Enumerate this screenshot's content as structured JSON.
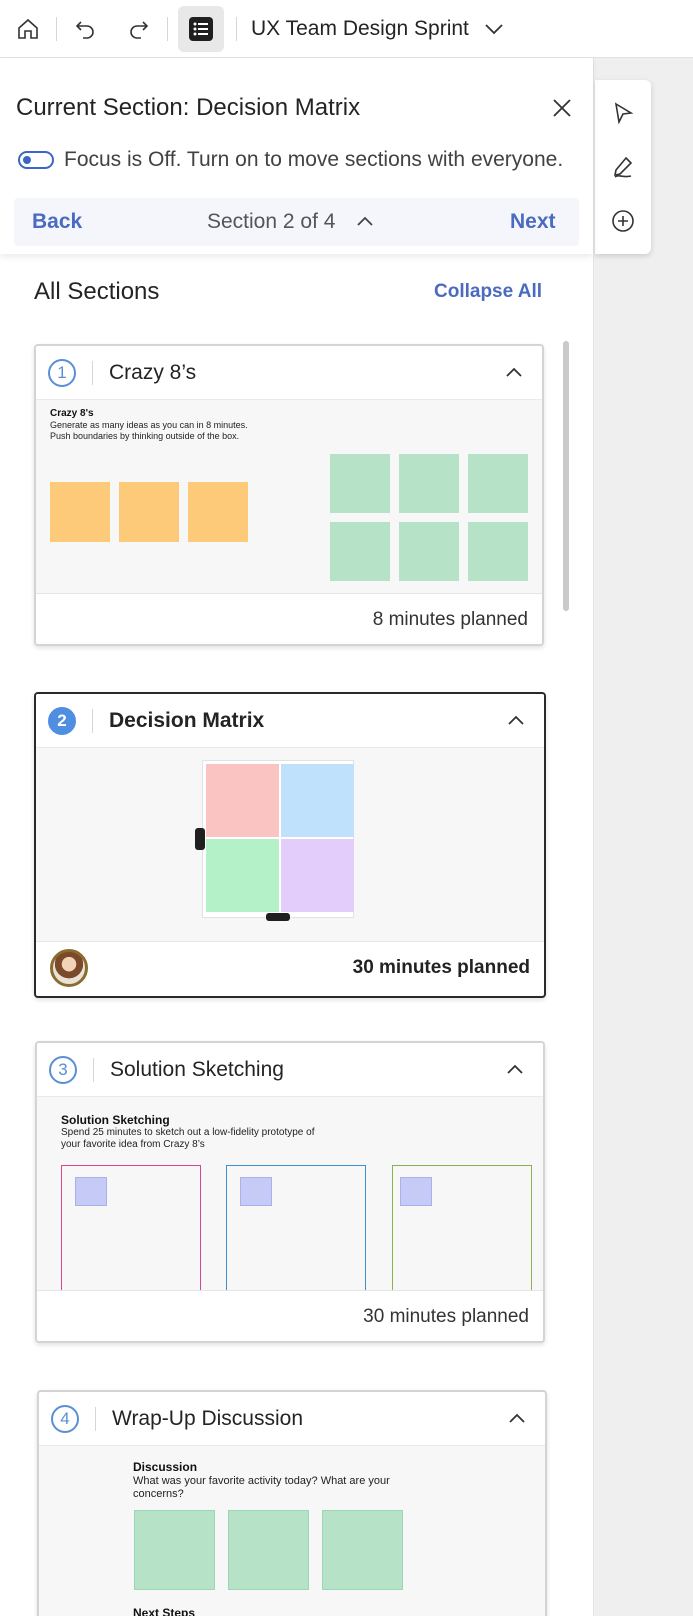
{
  "toolbar": {
    "board_title": "UX Team Design Sprint",
    "icons": [
      "home-icon",
      "undo-icon",
      "redo-icon",
      "sections-list-icon",
      "chevron-down-icon"
    ]
  },
  "right_tools": [
    "select-pointer-icon",
    "pen-icon",
    "add-icon"
  ],
  "panel": {
    "current_section_title": "Current Section: Decision Matrix",
    "focus_text": "Focus is Off. Turn on to move sections with everyone.",
    "back_label": "Back",
    "section_position": "Section 2 of 4",
    "next_label": "Next",
    "all_sections_label": "All Sections",
    "collapse_all_label": "Collapse All"
  },
  "sections": [
    {
      "number": "1",
      "title": "Crazy 8’s",
      "planned": "8 minutes planned",
      "preview_title": "Crazy 8's",
      "preview_text": "Generate as many ideas as you can in 8 minutes. Push boundaries by thinking outside of the box."
    },
    {
      "number": "2",
      "title": "Decision Matrix",
      "planned": "30 minutes planned",
      "active": true
    },
    {
      "number": "3",
      "title": "Solution Sketching",
      "planned": "30 minutes planned",
      "preview_title": "Solution Sketching",
      "preview_text": "Spend 25 minutes to sketch out a low-fidelity prototype of your favorite idea from Crazy 8’s"
    },
    {
      "number": "4",
      "title": "Wrap-Up Discussion",
      "preview_title": "Discussion",
      "preview_text": "What was your favorite activity today? What are your concerns?",
      "preview_title_2": "Next Steps"
    }
  ],
  "colors": {
    "accent": "#4a6bbf",
    "sticky_orange": "#fdca79",
    "sticky_green": "#b6e3c8",
    "matrix_red": "#f9c4c2",
    "matrix_blue": "#bfe1fb",
    "matrix_green": "#b4f1c8",
    "matrix_purple": "#e2cdfb"
  }
}
